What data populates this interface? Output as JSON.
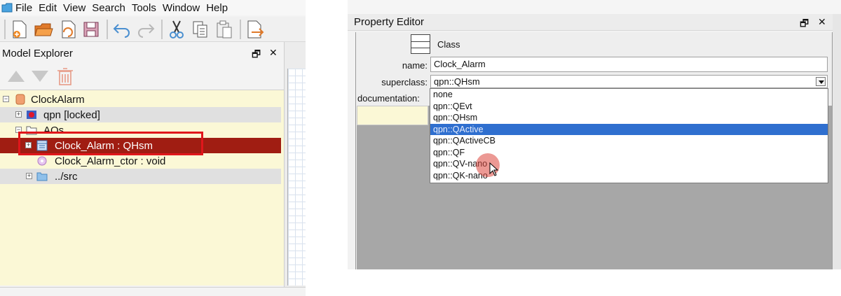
{
  "menubar": {
    "items": [
      "File",
      "Edit",
      "View",
      "Search",
      "Tools",
      "Window",
      "Help"
    ]
  },
  "toolbar": {
    "icons": [
      "new-file-icon",
      "open-folder-icon",
      "reload-icon",
      "save-icon",
      "undo-icon",
      "redo-icon",
      "cut-icon",
      "copy-icon",
      "paste-icon",
      "export-icon"
    ]
  },
  "model_explorer": {
    "title": "Model Explorer",
    "restore_glyph": "🗗",
    "close_glyph": "✕",
    "tree": [
      {
        "label": "ClockAlarm",
        "icon": "model-icon",
        "level": 0
      },
      {
        "label": "qpn [locked]",
        "icon": "package-locked-icon",
        "level": 1
      },
      {
        "label": "AOs",
        "icon": "folder-icon",
        "level": 1
      },
      {
        "label": "Clock_Alarm : QHsm",
        "icon": "class-icon",
        "level": 2,
        "selected": true
      },
      {
        "label": "Clock_Alarm_ctor : void",
        "icon": "operation-icon",
        "level": 2
      },
      {
        "label": "../src",
        "icon": "directory-icon",
        "level": 1
      }
    ]
  },
  "property_editor": {
    "title": "Property Editor",
    "restore_glyph": "🗗",
    "close_glyph": "✕",
    "class_label": "Class",
    "name_label": "name:",
    "name_value": "Clock_Alarm",
    "superclass_label": "superclass:",
    "superclass_value": "qpn::QHsm",
    "documentation_label": "documentation:",
    "superclass_options": [
      "none",
      "qpn::QEvt",
      "qpn::QHsm",
      "qpn::QActive",
      "qpn::QActiveCB",
      "qpn::QF",
      "qpn::QV-nano",
      "qpn::QK-nano"
    ],
    "highlighted_option": "qpn::QActive"
  },
  "colors": {
    "selection_red": "#a01d12",
    "highlight_box": "#e0161b",
    "dropdown_highlight": "#2f6fcf",
    "tree_background": "#fbf8d6"
  }
}
